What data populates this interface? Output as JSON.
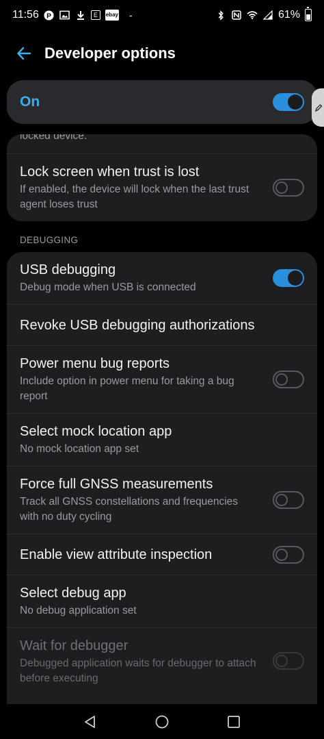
{
  "status_bar": {
    "time": "11:56",
    "battery": "61%",
    "battery_level": 0.61,
    "left_icons": [
      "pinterest-icon",
      "image-icon",
      "download-icon",
      "etsy-icon",
      "ebay-icon"
    ],
    "ebay_label": "ebay",
    "etsy_label": "E",
    "pinterest_label": "P",
    "dash": "-"
  },
  "app_bar": {
    "title": "Developer options"
  },
  "master_switch": {
    "label": "On",
    "state": true
  },
  "card_top": {
    "partial_subtitle": "locked device.",
    "items": [
      {
        "title": "Lock screen when trust is lost",
        "subtitle": "If enabled, the device will lock when the last trust agent loses trust",
        "toggle": false
      }
    ]
  },
  "section": {
    "header": "DEBUGGING"
  },
  "debugging": {
    "items": [
      {
        "title": "USB debugging",
        "subtitle": "Debug mode when USB is connected",
        "toggle": true
      },
      {
        "title": "Revoke USB debugging authorizations"
      },
      {
        "title": "Power menu bug reports",
        "subtitle": "Include option in power menu for taking a bug report",
        "toggle": false
      },
      {
        "title": "Select mock location app",
        "subtitle": "No mock location app set"
      },
      {
        "title": "Force full GNSS measurements",
        "subtitle": "Track all GNSS constellations and frequencies with no duty cycling",
        "toggle": false
      },
      {
        "title": "Enable view attribute inspection",
        "toggle": false
      },
      {
        "title": "Select debug app",
        "subtitle": "No debug application set"
      },
      {
        "title": "Wait for debugger",
        "subtitle": "Debugged application waits for debugger to attach before executing",
        "toggle": false,
        "disabled": true
      }
    ]
  },
  "colors": {
    "accent": "#3daee9",
    "toggle_on": "#2a8fdc",
    "card_bg": "#1e1e20",
    "background": "#000000"
  }
}
